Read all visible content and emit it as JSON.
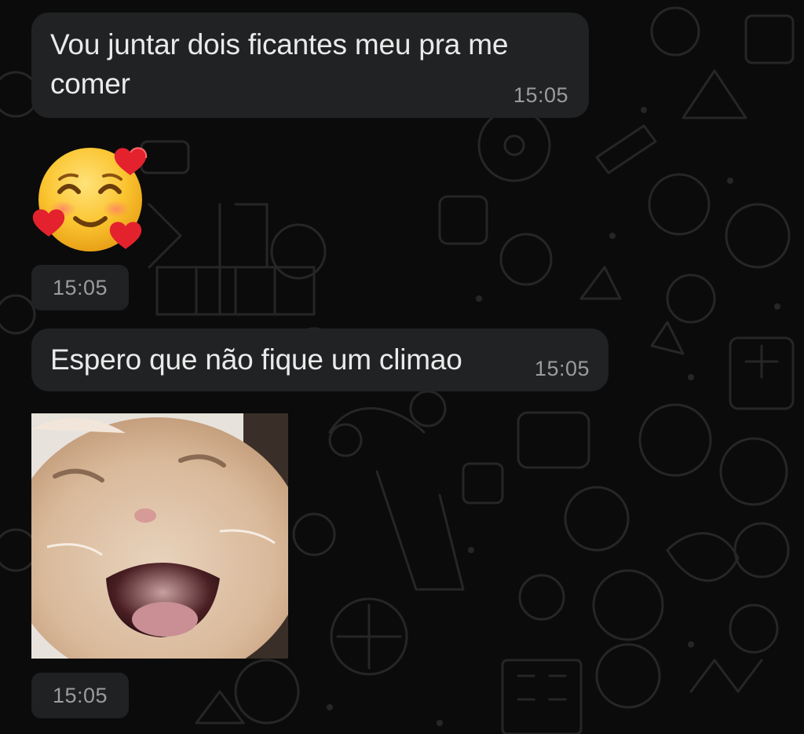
{
  "messages": [
    {
      "type": "text",
      "text": "Vou juntar dois ficantes meu pra me comer",
      "time": "15:05"
    },
    {
      "type": "sticker",
      "sticker": "smiling-face-with-hearts-emoji",
      "time": "15:05"
    },
    {
      "type": "text",
      "text": "Espero que não fique um climao",
      "time": "15:05"
    },
    {
      "type": "sticker",
      "sticker": "laughing-cat-image",
      "time": "15:05"
    }
  ],
  "colors": {
    "background": "#0b0b0b",
    "bubble": "#202223",
    "text": "#eaeaea",
    "timestamp": "#9a9c9d"
  }
}
